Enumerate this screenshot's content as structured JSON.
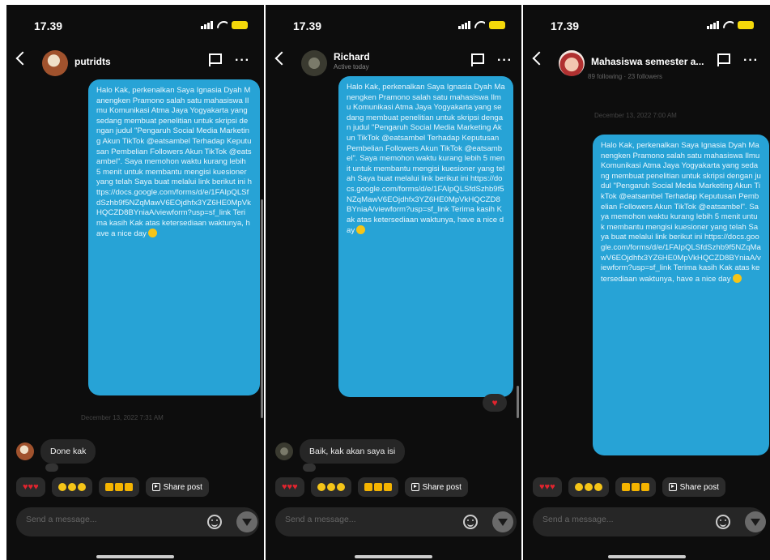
{
  "shared": {
    "time": "17.39",
    "message": "Halo Kak, perkenalkan Saya Ignasia Dyah Manengken Pramono salah satu mahasiswa Ilmu Komunikasi Atma Jaya Yogyakarta yang sedang membuat penelitian untuk skripsi dengan judul \"Pengaruh Social Media Marketing Akun TikTok @eatsambel Terhadap Keputusan Pembelian Followers Akun TikTok @eatsambel\". Saya memohon waktu kurang lebih 5 menit untuk membantu mengisi kuesioner yang telah Saya buat melalui link berikut ini https://docs.google.com/forms/d/e/1FAIpQLSfdSzhb9f5NZqMawV6EOjdhfx3YZ6HE0MpVkHQCZD8BYniaA/viewform?usp=sf_link Terima kasih Kak atas ketersediaan waktunya, have a nice day",
    "share_label": "Share post",
    "composer_placeholder": "Send a message...",
    "chip_hearts": "♥♥♥",
    "accent_color": "#27a3d6"
  },
  "panels": [
    {
      "username": "putridts",
      "subtitle": "",
      "timestamp": "December 13, 2022 7:31 AM",
      "reply": "Done kak"
    },
    {
      "username": "Richard",
      "subtitle": "Active today",
      "timestamp": "",
      "reply": "Baik, kak akan saya isi",
      "reaction": "♥"
    },
    {
      "username": "Mahasiswa semester a...",
      "subtitle": "",
      "profile_stats": "89 following · 23 followers",
      "timestamp": "December 13, 2022 7:00 AM",
      "reply": ""
    }
  ]
}
